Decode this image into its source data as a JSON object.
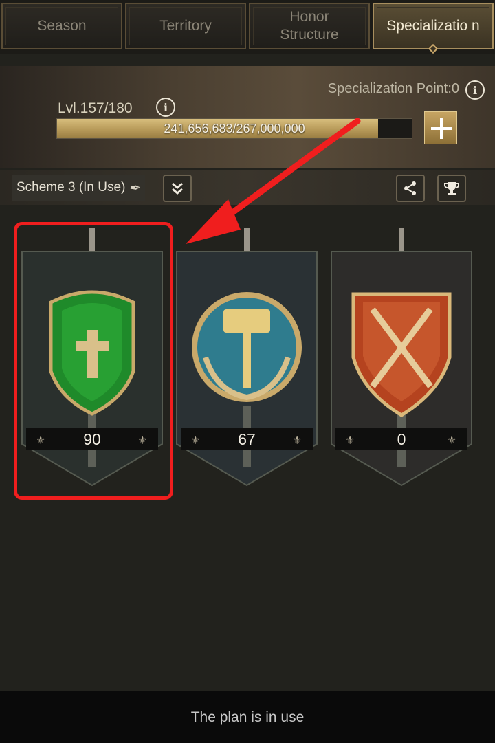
{
  "tabs": [
    {
      "label": "Season",
      "active": false
    },
    {
      "label": "Territory",
      "active": false
    },
    {
      "label": "Honor Structure",
      "active": false
    },
    {
      "label": "Specializatio n",
      "active": true
    }
  ],
  "header": {
    "spec_point_label": "Specialization Point:0",
    "level_label": "Lvl.157/180",
    "xp_text": "241,656,683/267,000,000",
    "xp_progress": 0.905
  },
  "scheme": {
    "label": "Scheme 3 (In Use)"
  },
  "cards": [
    {
      "value": "90",
      "emblem": "green-shield-cross-icon",
      "highlighted": true
    },
    {
      "value": "67",
      "emblem": "hammer-wreath-icon",
      "highlighted": false
    },
    {
      "value": "0",
      "emblem": "crossed-weapons-shield-icon",
      "highlighted": false
    }
  ],
  "footer": {
    "message": "The plan is in use"
  },
  "colors": {
    "accent_gold": "#c7a563",
    "annotation_red": "#f01e1e",
    "card_green": "#1f8a2a",
    "card_blue": "#2f7c8e",
    "card_red": "#b5431f"
  }
}
